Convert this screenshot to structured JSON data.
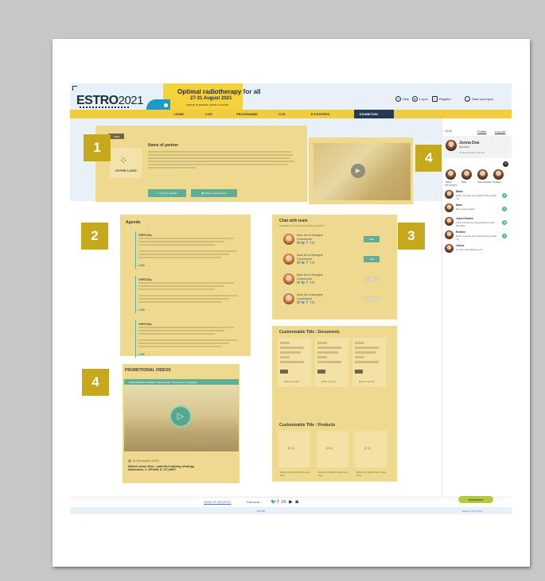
{
  "header": {
    "logo_main": "ESTRO",
    "logo_year": "2021",
    "tagline": "Optimal radiotherapy for all",
    "dates": "27-31 August 2021",
    "location": "ONSITE IN MADRID, SPAIN & ONLINE",
    "links": {
      "help": "Help",
      "login": "Log in",
      "register": "Register",
      "save": "Save your spot"
    }
  },
  "nav": [
    "HOME",
    "LIVE",
    "PROGRAMME",
    "VOD",
    "E-POSTERS",
    "EXHIBITION"
  ],
  "partner": {
    "back": "Back",
    "name": "Name of partner",
    "logo_text": "VOTRE LOGO",
    "visit_button": "Visit our website",
    "appointment_button": "Take an appointment"
  },
  "badges": [
    "1",
    "2",
    "3",
    "4",
    "4"
  ],
  "agenda": {
    "title": "Agenda",
    "items": [
      {
        "kind": "VIRTUAL",
        "link": "LINK"
      },
      {
        "kind": "VIRTUAL",
        "link": "LINK"
      },
      {
        "kind": "VIRTUAL",
        "link": "LINK"
      }
    ]
  },
  "chat": {
    "title": "Chat with team",
    "subtitle": "Available from 7:00 am to 8:00 pm (CEST)",
    "members": [
      {
        "name": "Marc de La Bruegère",
        "role": "Commercial",
        "button": "Chat"
      },
      {
        "name": "Marc de La Bruegère",
        "role": "Commercial",
        "button": "Chat"
      },
      {
        "name": "Marc de La Bruegère",
        "role": "Commercial",
        "button": "Chat"
      },
      {
        "name": "Marc de La Bruegère",
        "role": "Commercial",
        "button": "Chat"
      }
    ]
  },
  "documents": {
    "title": "Customizable Title : Documents",
    "cards": [
      "Book an event",
      "Other of event",
      "Book of events"
    ]
  },
  "products": {
    "title": "Customizable Title : Products",
    "cards": [
      {
        "image": "[1:1]",
        "caption": "Name of product that is very long"
      },
      {
        "image": "[1:1]",
        "caption": "Name of product that is very long"
      },
      {
        "image": "[1:1]",
        "caption": "Name of product that is very long"
      }
    ]
  },
  "promo": {
    "title": "PROMOTIONAL VIDEOS",
    "video_header": "Potential Marker Nuclear: Nanotherapy / Ultrasound Tomography",
    "date": "15 December 2020",
    "video_title": "Which came first : watchful waiting strategy",
    "moderators": "Moderators: C. SPOHN, D. OT-AMET"
  },
  "sidebar": {
    "time": "12:34",
    "profile": "Profile",
    "logout": "Log out",
    "user_name": "Jonna Doe",
    "user_role": "Speaker",
    "status": "Connected since 30 min",
    "contacts": [
      "Marie",
      "Marc",
      "Jean-Charles",
      "Emilien"
    ],
    "messages_label": "Messages",
    "messages": [
      {
        "name": "Marie",
        "text": "Hello, how are you doing? Did you like my",
        "count": "2"
      },
      {
        "name": "Marc",
        "text": "Nice presentation!",
        "count": "1"
      },
      {
        "name": "Jean-Charles",
        "text": "I didn't know you are working on this thoughts",
        "count": "3"
      },
      {
        "name": "Emilien",
        "text": "Hello, how are you doing? Did you like my",
        "count": "1"
      },
      {
        "name": "Jonna",
        "text": "I'm fine, what about you?",
        "count": ""
      }
    ]
  },
  "footer": {
    "industry": "NAME OF INDUSTRY",
    "find_us": "Find us on :",
    "assistance": "Assistance",
    "bottom_left": "ESTRO",
    "bottom_right": "Made by ♥ by Cyim"
  },
  "colors": {
    "panel": "#efd98f",
    "badge": "#c5a81c",
    "nav": "#f0cc3e",
    "nav_active": "#253a52",
    "accent": "#5fae96"
  }
}
